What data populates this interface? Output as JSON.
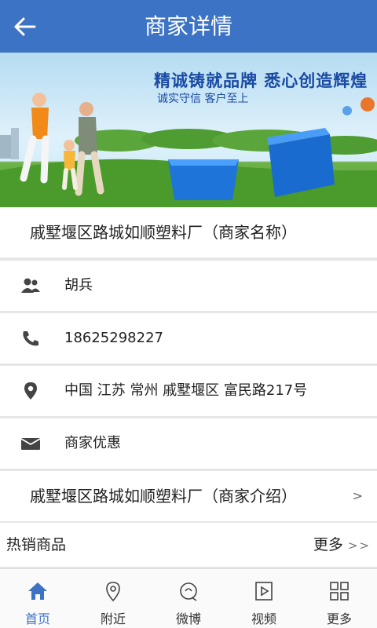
{
  "header": {
    "title": "商家详情"
  },
  "banner": {
    "slogan_main": "精诚铸就品牌   悉心创造辉煌",
    "slogan_sub": "诚实守信 客户至上"
  },
  "merchant": {
    "name": "戚墅堰区路城如顺塑料厂（商家名称）",
    "contact": "胡兵",
    "phone": "18625298227",
    "address": "中国 江苏 常州 戚墅堰区 富民路217号",
    "offers": "商家优惠",
    "intro": "戚墅堰区路城如顺塑料厂（商家介绍）"
  },
  "hot": {
    "title": "热销商品",
    "more": "更多",
    "more_glyph": ">>"
  },
  "tabs": [
    {
      "label": "首页",
      "icon": "home-icon",
      "active": true
    },
    {
      "label": "附近",
      "icon": "location-icon"
    },
    {
      "label": "微博",
      "icon": "weibo-icon"
    },
    {
      "label": "视频",
      "icon": "video-icon"
    },
    {
      "label": "更多",
      "icon": "grid-icon"
    }
  ],
  "colors": {
    "brand": "#3d73c5"
  }
}
